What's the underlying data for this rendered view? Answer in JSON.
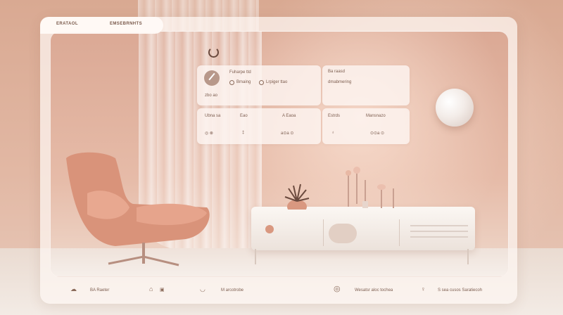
{
  "header": {
    "tab1": "ERATAOL",
    "tab2": "EMSEBRNHTS"
  },
  "cards": {
    "top_left": {
      "title": "Fuharpe ttd",
      "opt1": "Bmaing",
      "opt2": "Lrpiger ttao",
      "sub": "zbo ao"
    },
    "top_right": {
      "title": "Ba raasd",
      "sub": "dmabmering"
    },
    "bottom_left": {
      "col1": "Ubna sa",
      "col2": "Eao",
      "col3": "A Eaoa",
      "v1": "◎ ⊗",
      "v2": "‡",
      "v3": "a⊙a ⊙"
    },
    "bottom_right": {
      "col1": "Estrds",
      "col2": "Mansnazo",
      "v1": "♁",
      "v2": "⊙⊙a ⊙"
    }
  },
  "bottom_nav": [
    {
      "label": "BA Raeter",
      "icon": "cloud-icon"
    },
    {
      "label": "",
      "icon": "home-icon"
    },
    {
      "label": "M arcotrobe",
      "icon": "mug-icon"
    },
    {
      "label": "Wesatsr aloc tochea",
      "icon": "circle-icon"
    },
    {
      "label": "S sea cusos Saratiecoh",
      "icon": "light-icon"
    }
  ],
  "colors": {
    "accent": "#d99880",
    "wall": "#e2b8a4",
    "text": "#7d5e50"
  }
}
